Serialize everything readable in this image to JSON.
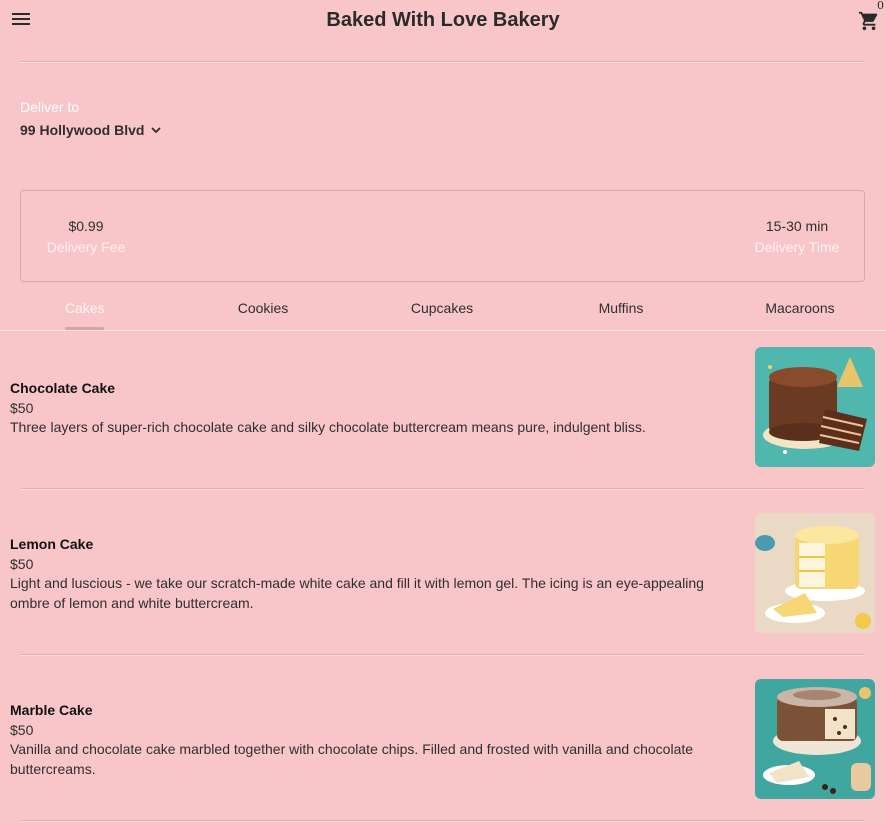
{
  "header": {
    "title": "Baked With Love Bakery",
    "menu_icon": "menu-icon",
    "cart_icon": "cart-icon",
    "cart_count": "0"
  },
  "delivery": {
    "label": "Deliver to",
    "address": "99 Hollywood Blvd",
    "dropdown_icon": "chevron-down-icon"
  },
  "info": {
    "fee_value": "$0.99",
    "fee_label": "Delivery Fee",
    "time_value": "15-30 min",
    "time_label": "Delivery Time"
  },
  "tabs": [
    {
      "label": "Cakes",
      "active": true
    },
    {
      "label": "Cookies",
      "active": false
    },
    {
      "label": "Cupcakes",
      "active": false
    },
    {
      "label": "Muffins",
      "active": false
    },
    {
      "label": "Macaroons",
      "active": false
    }
  ],
  "items": [
    {
      "name": "Chocolate Cake",
      "price": "$50",
      "description": "Three layers of super-rich chocolate cake and silky chocolate buttercream means pure, indulgent bliss."
    },
    {
      "name": "Lemon Cake",
      "price": "$50",
      "description": "Light and luscious - we take our scratch-made white cake and fill it with lemon gel. The icing is an eye-appealing ombre of lemon and white buttercream."
    },
    {
      "name": "Marble Cake",
      "price": "$50",
      "description": "Vanilla and chocolate cake marbled together with chocolate chips. Filled and frosted with vanilla and chocolate buttercreams."
    }
  ],
  "colors": {
    "background": "#f8c6c9",
    "accent": "#d5a4a8"
  }
}
